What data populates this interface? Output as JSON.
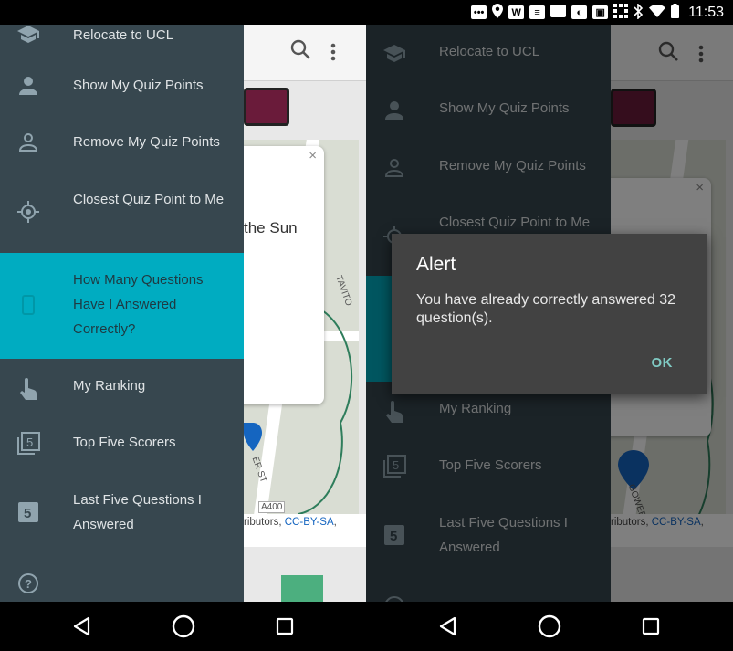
{
  "status_bar": {
    "time": "11:53",
    "icons": [
      "chat-icon",
      "location-icon",
      "w-icon",
      "notes-icon",
      "image-icon",
      "app-icon",
      "photo-icon",
      "grid-icon",
      "bluetooth-icon",
      "wifi-icon",
      "battery-icon"
    ],
    "w_glyph": "W"
  },
  "drawer": {
    "items": [
      {
        "label": "Relocate to UCL",
        "icon": "school-icon"
      },
      {
        "label": "Show My Quiz Points",
        "icon": "person-icon"
      },
      {
        "label": "Remove My Quiz Points",
        "icon": "person-outline-icon"
      },
      {
        "label": "Closest Quiz Point to Me",
        "icon": "gps-icon"
      },
      {
        "label": "How Many Questions Have I Answered Correctly?",
        "icon": "phone-icon"
      },
      {
        "label": "My Ranking",
        "icon": "touch-icon"
      },
      {
        "label": "Top Five Scorers",
        "icon": "filter-5-icon"
      },
      {
        "label": "Last Five Questions I Answered",
        "icon": "looks-5-icon"
      },
      {
        "label": "",
        "icon": "help-icon"
      }
    ],
    "number_glyph": "5",
    "active_index": 4,
    "colors": {
      "background": "#37474f",
      "active": "#00acc1",
      "text": "#dfe3e5"
    }
  },
  "map_view": {
    "card_text": "the Sun",
    "attribution_prefix": "ributors,",
    "attribution_link": "CC-BY-SA",
    "attribution_suffix": ",",
    "street_badge": "A400",
    "street_name_1": "TAVITO",
    "street_name_2": "ER ST",
    "street_name_gower": "GOWER S",
    "close_glyph": "×"
  },
  "alert": {
    "title": "Alert",
    "message": "You have already correctly answered 32 question(s).",
    "ok_label": "OK"
  },
  "nav_bar": {
    "buttons": [
      "back",
      "home",
      "recents"
    ]
  }
}
